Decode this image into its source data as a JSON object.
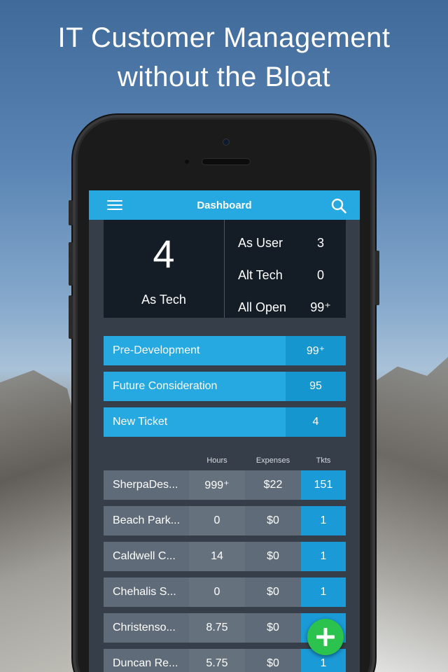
{
  "headline": {
    "line1": "IT Customer Management",
    "line2": "without the Bloat"
  },
  "appbar": {
    "title": "Dashboard"
  },
  "stats": {
    "main_value": "4",
    "main_label": "As Tech",
    "rows": [
      {
        "label": "As User",
        "value": "3"
      },
      {
        "label": "Alt Tech",
        "value": "0"
      },
      {
        "label": "All Open",
        "value": "99⁺"
      }
    ]
  },
  "stages": [
    {
      "label": "Pre-Development",
      "count": "99⁺"
    },
    {
      "label": "Future Consideration",
      "count": "95"
    },
    {
      "label": "New Ticket",
      "count": "4"
    }
  ],
  "accounts": {
    "headers": {
      "hours": "Hours",
      "expenses": "Expenses",
      "tkts": "Tkts"
    },
    "rows": [
      {
        "name": "SherpaDes...",
        "hours": "999⁺",
        "expenses": "$22",
        "tkts": "151"
      },
      {
        "name": "Beach Park...",
        "hours": "0",
        "expenses": "$0",
        "tkts": "1"
      },
      {
        "name": "Caldwell C...",
        "hours": "14",
        "expenses": "$0",
        "tkts": "1"
      },
      {
        "name": "Chehalis S...",
        "hours": "0",
        "expenses": "$0",
        "tkts": "1"
      },
      {
        "name": "Christenso...",
        "hours": "8.75",
        "expenses": "$0",
        "tkts": "1"
      },
      {
        "name": "Duncan Re...",
        "hours": "5.75",
        "expenses": "$0",
        "tkts": "1"
      }
    ]
  },
  "icons": {
    "menu": "hamburger-menu-icon",
    "search": "search-icon",
    "add": "plus-icon"
  },
  "colors": {
    "primary": "#25a9e0",
    "primary_dark": "#1696cf",
    "fab": "#2cc24e",
    "screen_bg": "#353e49",
    "stats_bg": "#141c25"
  }
}
